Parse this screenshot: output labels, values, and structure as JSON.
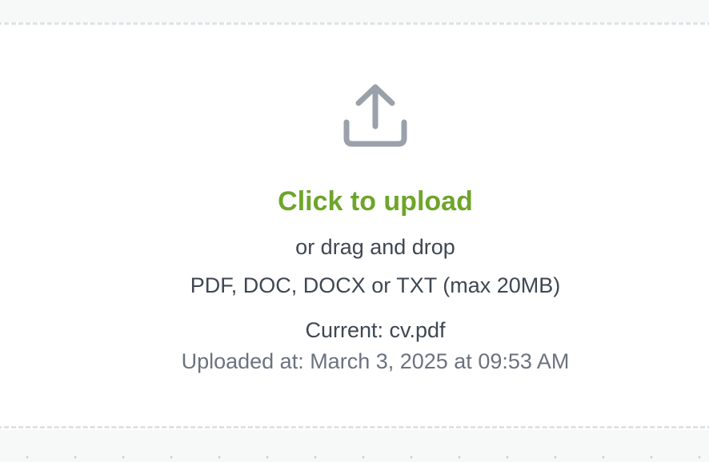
{
  "dropzone": {
    "icon": "upload-icon",
    "click_label": "Click to upload",
    "drag_label": "or drag and drop",
    "formats_label": "PDF, DOC, DOCX or TXT (max 20MB)",
    "current_file": "Current: cv.pdf",
    "uploaded_at": "Uploaded at: March 3, 2025 at 09:53 AM"
  },
  "colors": {
    "accent": "#6ea52a",
    "icon": "#9aa1ab",
    "text": "#3f4752",
    "muted_text": "#6b7280",
    "dashed_border": "#dfe2e6"
  }
}
